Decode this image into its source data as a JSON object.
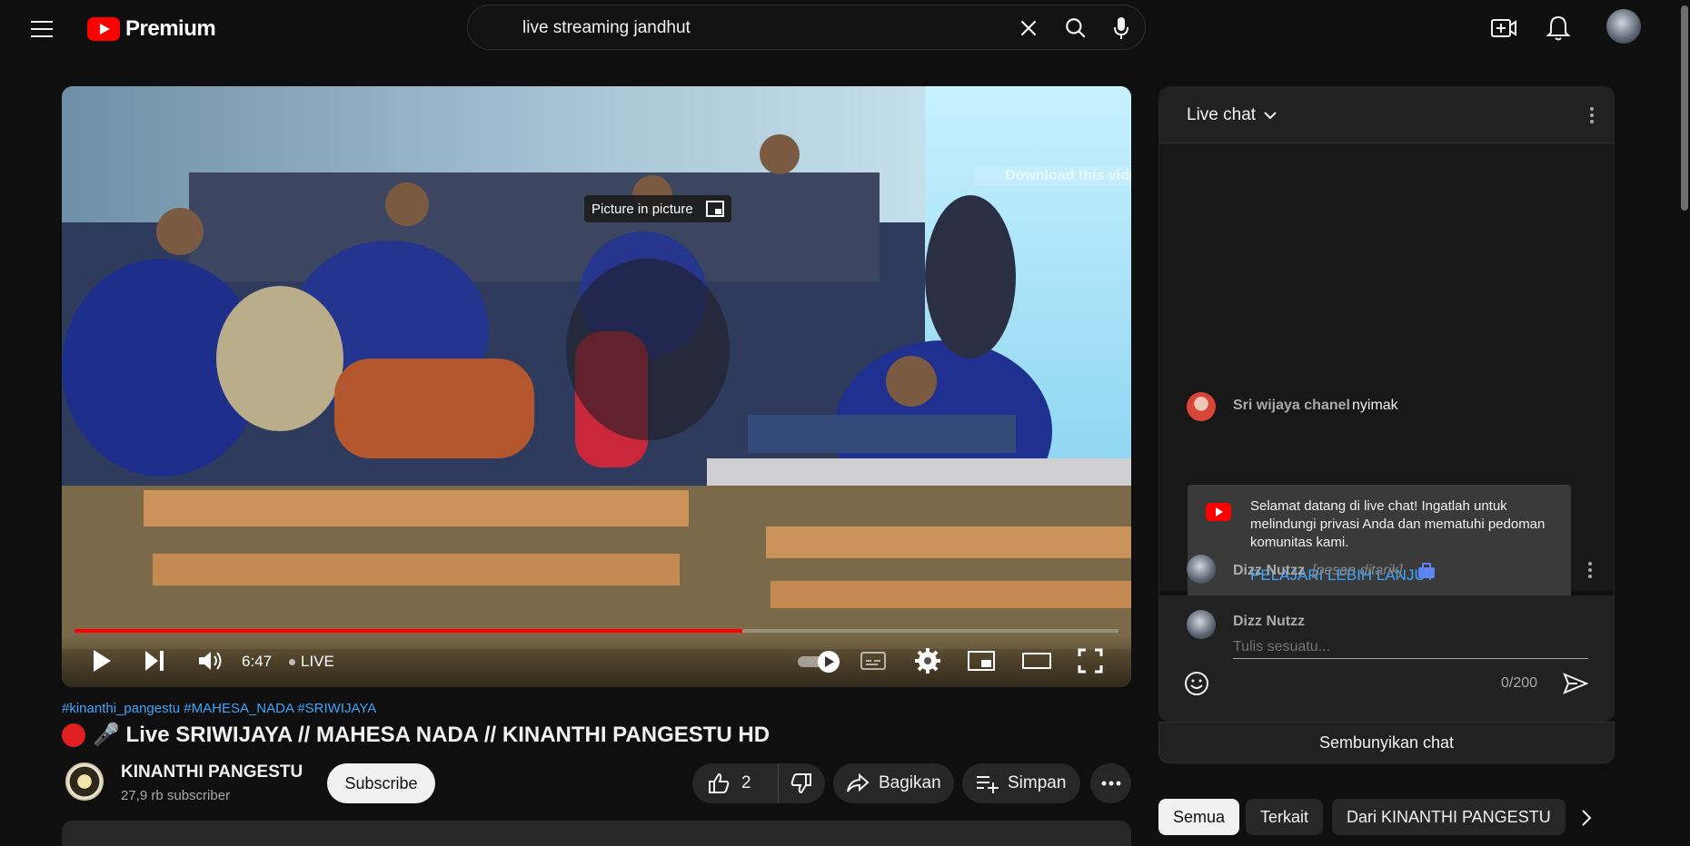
{
  "header": {
    "brand": "Premium",
    "search_value": "live streaming jandhut"
  },
  "player": {
    "pip_tooltip": "Picture in picture",
    "download_label": "Download this video",
    "time": "6:47",
    "live_label": "LIVE",
    "progress_fraction": 0.64
  },
  "video": {
    "hashtags": "#kinanthi_pangestu #MAHESA_NADA #SRIWIJAYA",
    "title": "🎤 Live SRIWIJAYA // MAHESA NADA // KINANTHI PANGESTU HD",
    "channel_name": "KINANTHI PANGESTU",
    "subscribers": "27,9 rb subscriber",
    "subscribe_label": "Subscribe",
    "like_count": "2",
    "share_label": "Bagikan",
    "save_label": "Simpan"
  },
  "chat": {
    "title": "Live chat",
    "messages": [
      {
        "author": "Sri wijaya chanel",
        "text": "nyimak"
      },
      {
        "author": "Dizz Nutzz",
        "text": "[pesan ditarik]"
      }
    ],
    "notice_text": "Selamat datang di live chat! Ingatlah untuk melindungi privasi Anda dan mematuhi pedoman komunitas kami.",
    "notice_link": "PELAJARI LEBIH LANJUT",
    "input_author": "Dizz Nutzz",
    "input_placeholder": "Tulis sesuatu...",
    "char_count": "0/200",
    "hide_label": "Sembunyikan chat"
  },
  "chips": [
    "Semua",
    "Terkait",
    "Dari KINANTHI PANGESTU"
  ],
  "colors": {
    "accent_red": "#ff0000",
    "link_blue": "#3ea6ff",
    "background": "#0f0f0f"
  }
}
